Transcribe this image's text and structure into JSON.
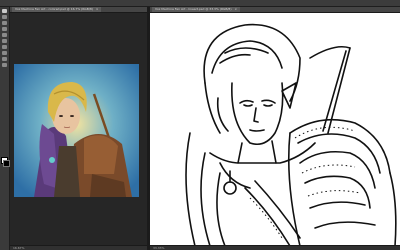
{
  "documents": [
    {
      "tab_title": "Vox Machina Fan Art - colored.psd @ 16.7% (RGB/8)"
    },
    {
      "tab_title": "Vox Machina Fan Art - lineart.psd @ 33.3% (RGB/8)"
    }
  ],
  "status": {
    "zoom_left": "16.67%",
    "zoom_right": "33.33%"
  },
  "colors": {
    "foreground": "#ffffff",
    "background": "#000000"
  },
  "icons": [
    "move-tool-icon",
    "marquee-tool-icon",
    "lasso-tool-icon",
    "crop-tool-icon",
    "eyedropper-tool-icon",
    "brush-tool-icon",
    "eraser-tool-icon",
    "text-tool-icon",
    "hand-tool-icon",
    "zoom-tool-icon"
  ]
}
